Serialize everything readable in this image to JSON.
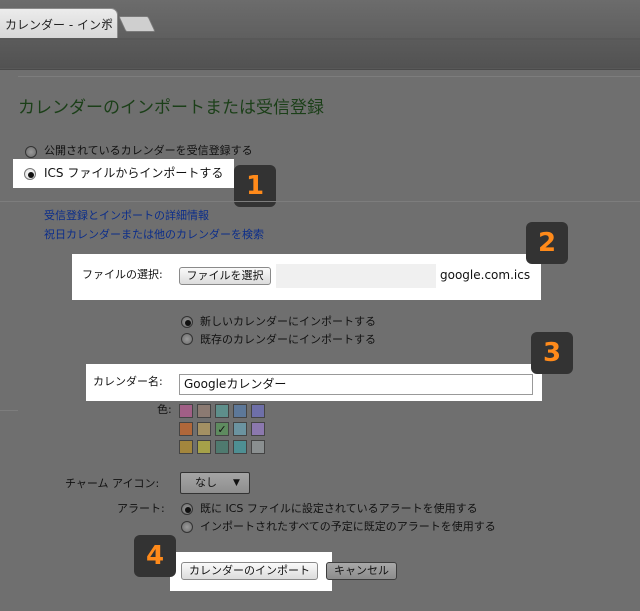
{
  "tab": {
    "title": "カレンダー - インポ",
    "close": "×"
  },
  "page": {
    "title": "カレンダーのインポートまたは受信登録"
  },
  "options": {
    "subscribe_public": "公開されているカレンダーを受信登録する",
    "import_ics": "ICS ファイルからインポートする"
  },
  "links": {
    "details": "受信登録とインポートの詳細情報",
    "holiday": "祝日カレンダーまたは他のカレンダーを検索"
  },
  "file": {
    "label": "ファイルの選択:",
    "button": "ファイルを選択",
    "filename": "google.com.ics"
  },
  "target": {
    "new_calendar": "新しいカレンダーにインポートする",
    "existing_calendar": "既存のカレンダーにインポートする"
  },
  "calendar_name": {
    "label": "カレンダー名:",
    "value": "Googleカレンダー"
  },
  "color": {
    "label": "色:",
    "selected_mark": "✓",
    "swatches": [
      "#a15f86",
      "#8b7a72",
      "#5e8f8b",
      "#5d7899",
      "#6e6fa8",
      "#b0673a",
      "#a39063",
      "#5e8b5f",
      "#6b93a0",
      "#8b78ae",
      "#a3863d",
      "#a5a149",
      "#4f7a6f",
      "#4e8f93",
      "#8a8f90"
    ]
  },
  "charm": {
    "label": "チャーム アイコン:",
    "value": "なし",
    "arrow": "▼"
  },
  "alert": {
    "label": "アラート:",
    "use_ics": "既に ICS ファイルに設定されているアラートを使用する",
    "use_default": "インポートされたすべての予定に既定のアラートを使用する"
  },
  "actions": {
    "import": "カレンダーのインポート",
    "cancel": "キャンセル"
  },
  "badges": {
    "b1": "1",
    "b2": "2",
    "b3": "3",
    "b4": "4"
  }
}
